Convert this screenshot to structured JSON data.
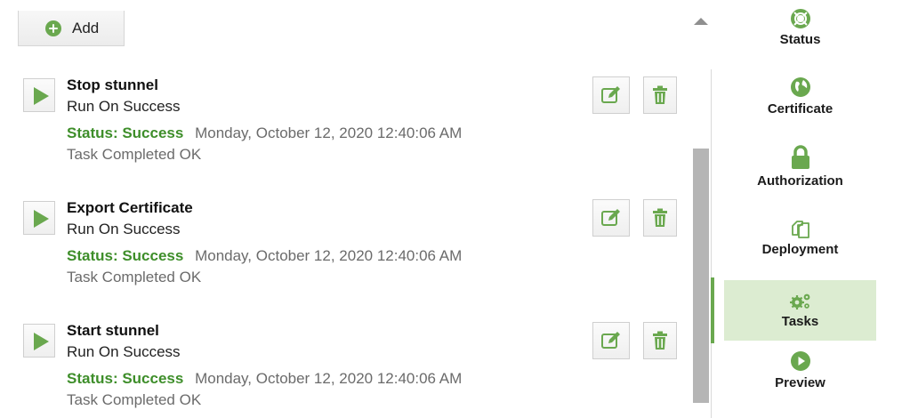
{
  "toolbar": {
    "add_label": "Add",
    "add_icon": "plus-circle-icon"
  },
  "tasks": [
    {
      "title": "Stop stunnel",
      "trigger": "Run On Success",
      "status_label": "Status: Success",
      "status_date": "Monday, October 12, 2020 12:40:06 AM",
      "result": "Task Completed OK"
    },
    {
      "title": "Export Certificate",
      "trigger": "Run On Success",
      "status_label": "Status: Success",
      "status_date": "Monday, October 12, 2020 12:40:06 AM",
      "result": "Task Completed OK"
    },
    {
      "title": "Start stunnel",
      "trigger": "Run On Success",
      "status_label": "Status: Success",
      "status_date": "Monday, October 12, 2020 12:40:06 AM",
      "result": "Task Completed OK"
    }
  ],
  "nav": {
    "items": [
      {
        "label": "Status",
        "icon": "lifebuoy-icon"
      },
      {
        "label": "Certificate",
        "icon": "globe-icon"
      },
      {
        "label": "Authorization",
        "icon": "lock-icon"
      },
      {
        "label": "Deployment",
        "icon": "copy-icon"
      },
      {
        "label": "Tasks",
        "icon": "gears-icon",
        "active": true
      },
      {
        "label": "Preview",
        "icon": "play-circle-icon"
      }
    ]
  },
  "colors": {
    "accent": "#6aa84f",
    "success_text": "#3e8e2a",
    "active_nav_bg": "#dcecd1",
    "muted_text": "#6b6b6b"
  }
}
